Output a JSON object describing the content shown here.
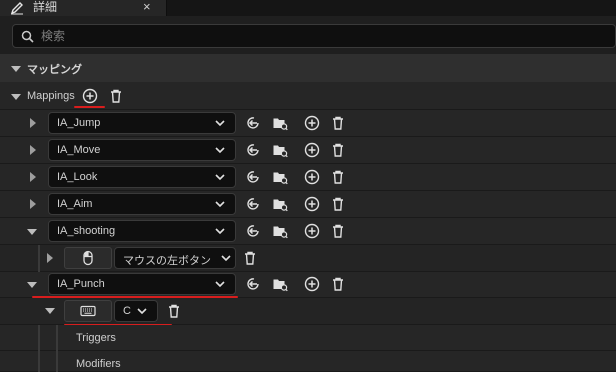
{
  "tab": {
    "title": "詳細",
    "close": "×",
    "icon": "pencil-icon"
  },
  "search": {
    "placeholder": "検索"
  },
  "category": {
    "label": "マッピング"
  },
  "mappings": {
    "label": "Mappings"
  },
  "actions": [
    {
      "name": "IA_Jump"
    },
    {
      "name": "IA_Move"
    },
    {
      "name": "IA_Look"
    },
    {
      "name": "IA_Aim"
    },
    {
      "name": "IA_shooting"
    },
    {
      "name": "IA_Punch"
    }
  ],
  "shooting_binding": {
    "key": "マウスの左ボタン",
    "icon": "mouse-icon"
  },
  "punch_binding": {
    "key": "C",
    "icon": "keyboard-icon"
  },
  "sub_props": {
    "triggers": "Triggers",
    "modifiers": "Modifiers"
  },
  "colors": {
    "highlight": "#d81d1d",
    "background": "#1f1f1f",
    "row": "#262626"
  }
}
